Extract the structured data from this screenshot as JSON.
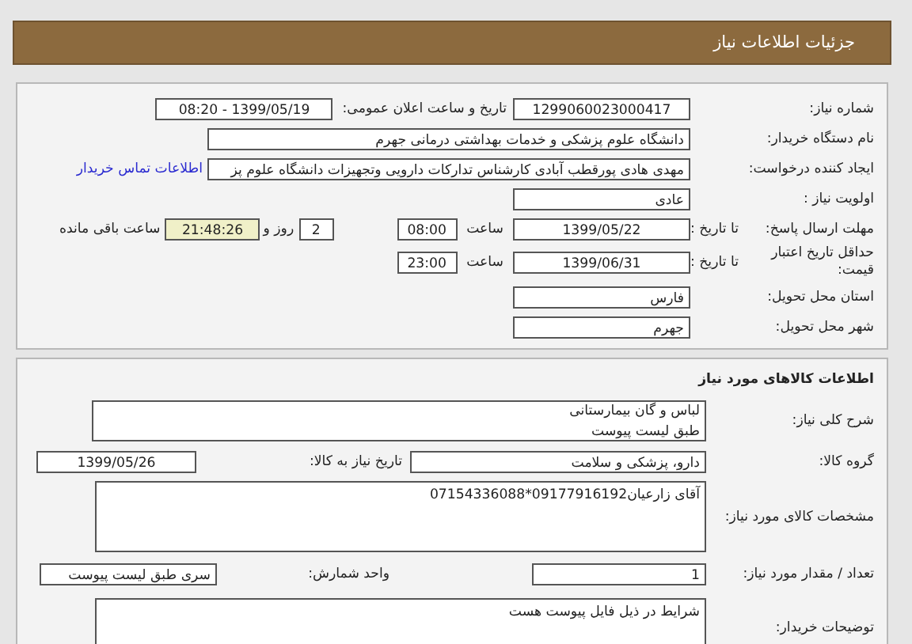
{
  "header": {
    "title": "جزئیات اطلاعات نیاز"
  },
  "need_details": {
    "need_number": {
      "label": "شماره نیاز:",
      "value": "1299060023000417"
    },
    "announce": {
      "label": "تاریخ و ساعت اعلان عمومی:",
      "value": "1399/05/19 - 08:20"
    },
    "buyer": {
      "label": "نام دستگاه خریدار:",
      "value": "دانشگاه علوم پزشکی و خدمات بهداشتی درمانی جهرم"
    },
    "requester": {
      "label": "ایجاد کننده درخواست:",
      "value": "مهدی هادی پورقطب آبادی کارشناس تدارکات دارویی وتجهیزات دانشگاه علوم پز",
      "link": "اطلاعات تماس خریدار"
    },
    "priority": {
      "label": "اولویت نیاز :",
      "value": "عادی"
    },
    "deadline": {
      "label": "مهلت ارسال پاسخ:",
      "date_label": "تا تاریخ :",
      "date": "1399/05/22",
      "time_label": "ساعت",
      "time": "08:00",
      "days": "2",
      "days_label": "روز و",
      "remaining": "21:48:26",
      "remaining_label": "ساعت باقی مانده"
    },
    "validity": {
      "label": "حداقل تاریخ اعتبار قیمت:",
      "date_label": "تا تاریخ :",
      "date": "1399/06/31",
      "time_label": "ساعت",
      "time": "23:00"
    },
    "province": {
      "label": "استان محل تحویل:",
      "value": "فارس"
    },
    "city": {
      "label": "شهر محل تحویل:",
      "value": "جهرم"
    }
  },
  "goods": {
    "title": "اطلاعات کالاهای مورد نیاز",
    "summary": {
      "label": "شرح کلی نیاز:",
      "lines": [
        "لباس و گان بیمارستانی",
        "طبق لیست پیوست"
      ]
    },
    "group": {
      "label": "گروه کالا:",
      "value": "دارو، پزشکی و سلامت",
      "date_label": "تاریخ نیاز به کالا:",
      "date": "1399/05/26"
    },
    "specs": {
      "label": "مشخصات کالای مورد نیاز:",
      "value": "آقای زارعیان09177916192*07154336088"
    },
    "quantity": {
      "label": "تعداد / مقدار مورد نیاز:",
      "value": "1",
      "unit_label": "واحد شمارش:",
      "unit": "سری طبق لیست پیوست"
    },
    "notes": {
      "label": "توضیحات خریدار:",
      "value": "شرایط در ذیل فایل پیوست هست"
    }
  }
}
